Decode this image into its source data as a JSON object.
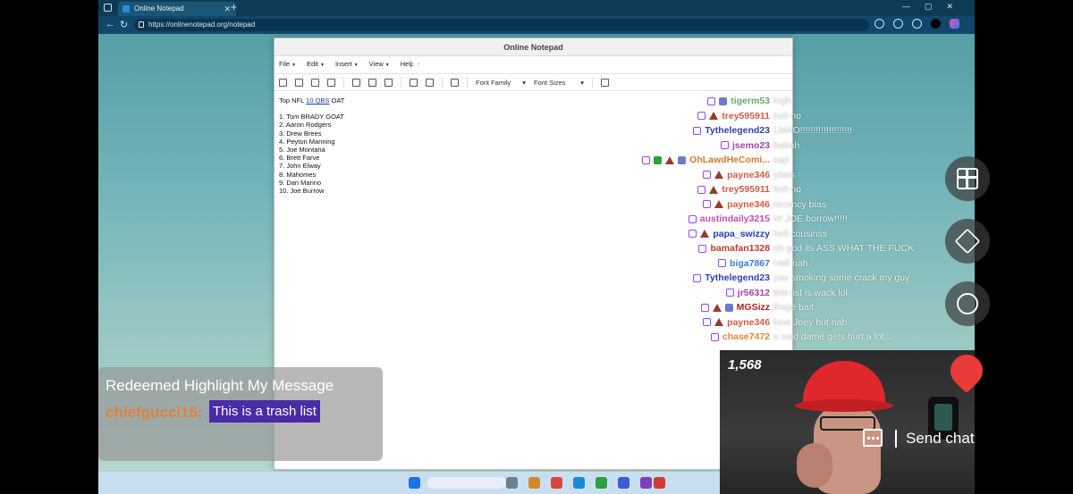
{
  "browser": {
    "tab_title": "Online Notepad",
    "url": "https://onlinenotepad.org/notepad"
  },
  "notepad": {
    "title": "Online Notepad",
    "menu": [
      "File",
      "Edit",
      "Insert",
      "View",
      "Help"
    ],
    "toolbar": {
      "font_family": "Font Family",
      "font_sizes": "Font Sizes"
    },
    "heading_prefix": "Top NFL ",
    "heading_link": "10 QBS",
    "heading_suffix": " OAT",
    "list": [
      "1. Tom BRADY GOAT",
      "2.  Aaron Rodgers",
      "3. Drew Brees",
      "4. Peyton Manning",
      "5. Joe Montana",
      "6. Brett Farve",
      "7. John Elway",
      "8. Mahomes",
      "9. Dan Marino",
      "10. Joe Burrow"
    ]
  },
  "chat": {
    "messages": [
      {
        "user": "tigerm53",
        "msg": "high",
        "color": "#6aa86a"
      },
      {
        "user": "trey595911",
        "msg": "hell no",
        "color": "#d25b43"
      },
      {
        "user": "Tythelegend23",
        "msg": "LMAO!!!!!!!!!!!!!!!!!!!!",
        "color": "#2f3fa8"
      },
      {
        "user": "jsemo23",
        "msg": "babah",
        "color": "#a043a8"
      },
      {
        "user": "OhLawdHeComi...",
        "msg": "cap",
        "color": "#d57a2a"
      },
      {
        "user": "payne346",
        "msg": "yikes",
        "color": "#d25b43"
      },
      {
        "user": "trey595911",
        "msg": "hell no",
        "color": "#d25b43"
      },
      {
        "user": "payne346",
        "msg": "recency bias",
        "color": "#d25b43"
      },
      {
        "user": "austindaily3215",
        "msg": "W JOE borrow!!!!!",
        "color": "#c84bb0"
      },
      {
        "user": "papa_swizzy",
        "msg": "hell cousinss",
        "color": "#1f3db8"
      },
      {
        "user": "bamafan1328",
        "msg": "oh god its ASS WHAT THE FUCK",
        "color": "#c0392b"
      },
      {
        "user": "biga7867",
        "msg": "Hell nah",
        "color": "#3a7bd5"
      },
      {
        "user": "Tythelegend23",
        "msg": "you smoking some crack my guy",
        "color": "#2f3fa8"
      },
      {
        "user": "jr56312",
        "msg": "this list is wack lol",
        "color": "#a043a8"
      },
      {
        "user": "MGSizz",
        "msg": "Rage bait",
        "color": "#b52020"
      },
      {
        "user": "payne346",
        "msg": "love Joey but nah",
        "color": "#d25b43"
      },
      {
        "user": "chase7472",
        "msg": "u said dame gets hurt a lot....",
        "color": "#d88a3c"
      }
    ]
  },
  "highlight": {
    "title": "Redeemed Highlight My Message",
    "user": "chiefgucci15:",
    "message": "This is a trash list"
  },
  "stream": {
    "viewer_count": "1,568",
    "send_chat_label": "Send chat"
  }
}
